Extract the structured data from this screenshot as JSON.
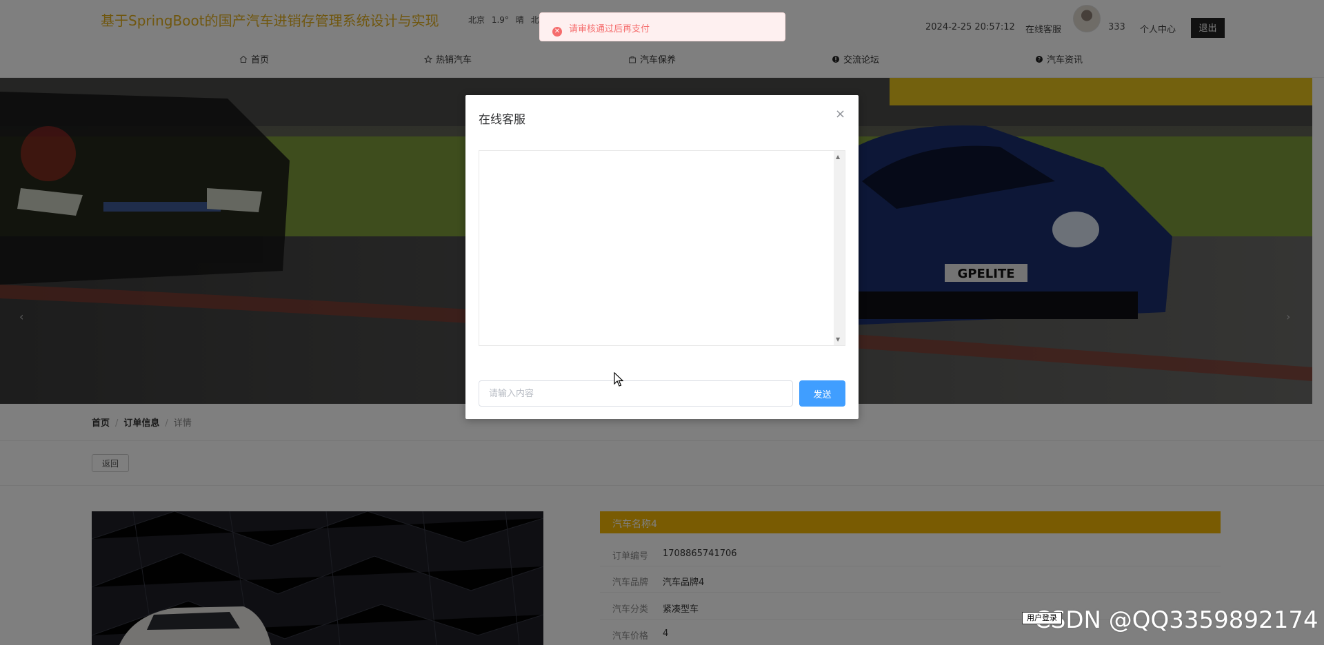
{
  "header": {
    "site_title": "基于SpringBoot的国产汽车进销存管理系统设计与实现",
    "weather": {
      "city": "北京",
      "temp": "1.9°",
      "condition": "晴",
      "wind": "北"
    },
    "datetime": "2024-2-25 20:57:12",
    "service_link": "在线客服",
    "username": "333",
    "profile_link": "个人中心",
    "logout_label": "退出"
  },
  "toast": {
    "message": "请审核通过后再支付",
    "color": "#f56c6c"
  },
  "nav": {
    "items": [
      {
        "label": "首页",
        "icon": "home-icon"
      },
      {
        "label": "热销汽车",
        "icon": "star-icon"
      },
      {
        "label": "汽车保养",
        "icon": "bag-icon"
      },
      {
        "label": "交流论坛",
        "icon": "info-icon"
      },
      {
        "label": "汽车资讯",
        "icon": "question-icon"
      }
    ]
  },
  "banner": {
    "prev_arrow": "‹",
    "next_arrow": "›",
    "plate_text": "GPELITE"
  },
  "breadcrumb": {
    "home": "首页",
    "section": "订单信息",
    "current": "详情",
    "separator": "/"
  },
  "back_label": "返回",
  "detail": {
    "name": "汽车名称4",
    "rows": [
      {
        "label": "订单编号",
        "value": "1708865741706"
      },
      {
        "label": "汽车品牌",
        "value": "汽车品牌4"
      },
      {
        "label": "汽车分类",
        "value": "紧凑型车"
      },
      {
        "label": "汽车价格",
        "value": "4"
      }
    ]
  },
  "modal": {
    "title": "在线客服",
    "close": "×",
    "input_placeholder": "请输入内容",
    "send_label": "发送"
  },
  "watermark": "CSDN @QQ3359892174",
  "tooltip": "用户登录",
  "colors": {
    "brand": "#e0ae1f",
    "accent": "#f2b705",
    "primary": "#409eff",
    "danger": "#f56c6c"
  }
}
